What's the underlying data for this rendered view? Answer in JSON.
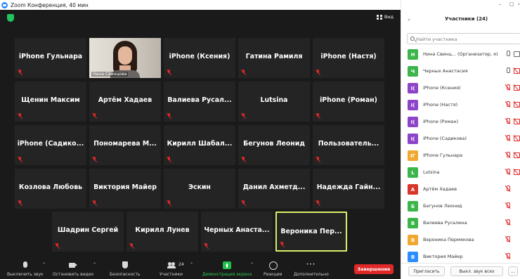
{
  "window": {
    "title": "Zoom Конференция, 40 мин"
  },
  "meeting": {
    "view_label": "Вид",
    "tiles": [
      [
        {
          "name": "iPhone Гульнара",
          "video": false,
          "active": false
        },
        {
          "name": "",
          "video": true,
          "camera_label": "Нина Свинцова",
          "active": false
        },
        {
          "name": "iPhone (Ксения)",
          "video": false,
          "active": false
        },
        {
          "name": "Гатина Рамиля",
          "video": false,
          "active": false
        },
        {
          "name": "iPhone (Настя)",
          "video": false,
          "active": false
        }
      ],
      [
        {
          "name": "Щенин Максим",
          "video": false,
          "active": false
        },
        {
          "name": "Артём Хадаев",
          "video": false,
          "active": false
        },
        {
          "name": "Валиева Русал...",
          "video": false,
          "active": false
        },
        {
          "name": "Lutsina",
          "video": false,
          "active": false
        },
        {
          "name": "iPhone (Роман)",
          "video": false,
          "active": false
        }
      ],
      [
        {
          "name": "iPhone (Садико...",
          "video": false,
          "active": false
        },
        {
          "name": "Пономарева М...",
          "video": false,
          "active": false
        },
        {
          "name": "Кирилл Шабал...",
          "video": false,
          "active": false
        },
        {
          "name": "Бегунов Леонид",
          "video": false,
          "active": false
        },
        {
          "name": "Пользователь...",
          "video": false,
          "active": false
        }
      ],
      [
        {
          "name": "Козлова Любовь",
          "video": false,
          "active": false
        },
        {
          "name": "Виктория Майер",
          "video": false,
          "active": false
        },
        {
          "name": "Эскин",
          "video": false,
          "active": false
        },
        {
          "name": "Данил Ахметд...",
          "video": false,
          "active": false
        },
        {
          "name": "Надежда Гайн...",
          "video": false,
          "active": false
        }
      ],
      [
        {
          "name": "Шадрин Сергей",
          "video": false,
          "active": false
        },
        {
          "name": "Кирилл Лунев",
          "video": false,
          "active": false
        },
        {
          "name": "Черных Анаста...",
          "video": false,
          "active": false
        },
        {
          "name": "Вероника Пер...",
          "video": false,
          "active": true
        }
      ]
    ]
  },
  "toolbar": {
    "mute_label": "Выключить звук",
    "video_label": "Остановить видео",
    "security_label": "Безопасность",
    "participants_label": "Участники",
    "participants_count": "24",
    "share_label": "Демонстрация экрана",
    "reactions_label": "Реакции",
    "more_label": "Дополнительно",
    "end_label": "Завершение"
  },
  "panel": {
    "title": "Участники (24)",
    "search_placeholder": "Найти участника",
    "participants": [
      {
        "initial": "Н",
        "color": "#3cb54a",
        "name": "Нина Свинц...  (Организатор, я)",
        "mic_muted": false,
        "cam_off": false
      },
      {
        "initial": "Ч",
        "color": "#3cb54a",
        "name": "Черных Анастасия",
        "mic_muted": false,
        "cam_off": true
      },
      {
        "initial": "I(",
        "color": "#8e44c9",
        "name": "iPhone (Ксения)",
        "mic_muted": true,
        "cam_off": true
      },
      {
        "initial": "I(",
        "color": "#8e44c9",
        "name": "iPhone (Настя)",
        "mic_muted": true,
        "cam_off": true
      },
      {
        "initial": "I(",
        "color": "#8e44c9",
        "name": "iPhone (Роман)",
        "mic_muted": true,
        "cam_off": true
      },
      {
        "initial": "I(",
        "color": "#8e44c9",
        "name": "iPhone (Садикова)",
        "mic_muted": true,
        "cam_off": true
      },
      {
        "initial": "IГ",
        "color": "#f0a830",
        "name": "iPhone Гульнара",
        "mic_muted": true,
        "cam_off": true
      },
      {
        "initial": "L",
        "color": "#3cb54a",
        "name": "Lutsina",
        "mic_muted": true,
        "cam_off": true
      },
      {
        "initial": "А",
        "color": "#d9362b",
        "name": "Артём Хадаев",
        "mic_muted": true,
        "cam_off": false
      },
      {
        "initial": "Б",
        "color": "#3cb54a",
        "name": "Бегунов Леонид",
        "mic_muted": true,
        "cam_off": false
      },
      {
        "initial": "В",
        "color": "#3cb54a",
        "name": "Валиева Русалина",
        "mic_muted": true,
        "cam_off": false
      },
      {
        "initial": "В",
        "color": "#f0a830",
        "name": "Вероника Пермякова",
        "mic_muted": true,
        "cam_off": false
      },
      {
        "initial": "В",
        "color": "#2d8cff",
        "name": "Виктория Майер",
        "mic_muted": true,
        "cam_off": false
      }
    ],
    "invite_label": "Пригласить",
    "mute_all_label": "Выкл. звук всех",
    "more_label": "..."
  }
}
